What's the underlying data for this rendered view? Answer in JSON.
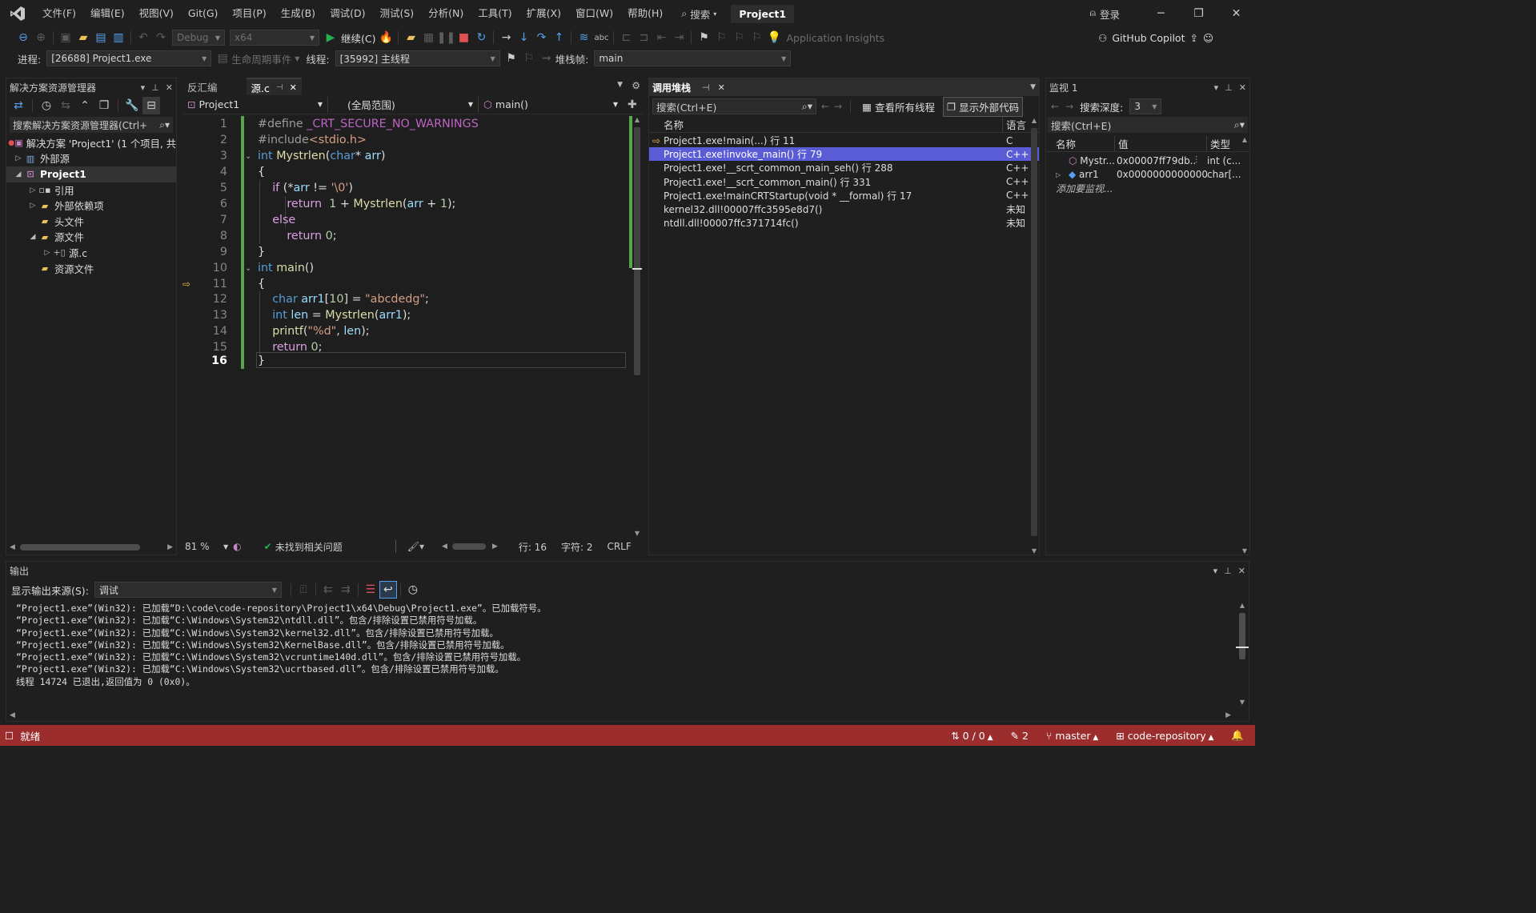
{
  "menu": {
    "items": [
      "文件(F)",
      "编辑(E)",
      "视图(V)",
      "Git(G)",
      "项目(P)",
      "生成(B)",
      "调试(D)",
      "测试(S)",
      "分析(N)",
      "工具(T)",
      "扩展(X)",
      "窗口(W)",
      "帮助(H)"
    ],
    "search_label": "搜索",
    "project_badge": "Project1",
    "login_label": "登录"
  },
  "toolbar": {
    "config": "Debug",
    "platform": "x64",
    "continue_label": "继续(C)",
    "app_insights": "Application Insights",
    "copilot": "GitHub Copilot"
  },
  "debugbar": {
    "process_label": "进程:",
    "process_value": "[26688] Project1.exe",
    "lifecycle_label": "生命周期事件",
    "thread_label": "线程:",
    "thread_value": "[35992] 主线程",
    "stackframe_label": "堆栈帧:",
    "stackframe_value": "main"
  },
  "solution_explorer": {
    "title": "解决方案资源管理器",
    "search_placeholder": "搜索解决方案资源管理器(Ctrl+",
    "items": [
      {
        "label": "解决方案 'Project1' (1 个项目, 共"
      },
      {
        "label": "外部源"
      },
      {
        "label": "Project1"
      },
      {
        "label": "引用"
      },
      {
        "label": "外部依赖项"
      },
      {
        "label": "头文件"
      },
      {
        "label": "源文件"
      },
      {
        "label": "源.c"
      },
      {
        "label": "资源文件"
      }
    ]
  },
  "editor": {
    "tabs": [
      {
        "label": "反汇编"
      },
      {
        "label": "源.c"
      }
    ],
    "nav_project": "Project1",
    "nav_scope": "(全局范围)",
    "nav_function": "main()",
    "zoom": "81 %",
    "issues": "未找到相关问题",
    "line_pos": "行: 16",
    "char_pos": "字符: 2",
    "eol": "CRLF",
    "line_numbers": [
      "1",
      "2",
      "3",
      "4",
      "5",
      "6",
      "7",
      "8",
      "9",
      "10",
      "11",
      "12",
      "13",
      "14",
      "15",
      "16"
    ]
  },
  "call_stack": {
    "title": "调用堆栈",
    "search_placeholder": "搜索(Ctrl+E)",
    "view_threads": "查看所有线程",
    "show_external": "显示外部代码",
    "col_name": "名称",
    "col_lang": "语言",
    "rows": [
      {
        "name": "Project1.exe!main(...) 行 11",
        "lang": "C"
      },
      {
        "name": "Project1.exe!invoke_main() 行 79",
        "lang": "C++"
      },
      {
        "name": "Project1.exe!__scrt_common_main_seh() 行 288",
        "lang": "C++"
      },
      {
        "name": "Project1.exe!__scrt_common_main() 行 331",
        "lang": "C++"
      },
      {
        "name": "Project1.exe!mainCRTStartup(void * __formal) 行 17",
        "lang": "C++"
      },
      {
        "name": "kernel32.dll!00007ffc3595e8d7()",
        "lang": "未知"
      },
      {
        "name": "ntdll.dll!00007ffc371714fc()",
        "lang": "未知"
      }
    ]
  },
  "watch": {
    "title": "监视 1",
    "depth_label": "搜索深度:",
    "depth_value": "3",
    "search_placeholder": "搜索(Ctrl+E)",
    "col_name": "名称",
    "col_value": "值",
    "col_type": "类型",
    "rows": [
      {
        "name": "Mystr...",
        "value": "0x00007ff79db...",
        "type": "int (c..."
      },
      {
        "name": "arr1",
        "value": "0x0000000000000...",
        "type": "char[..."
      }
    ],
    "add_item": "添加要监视..."
  },
  "output": {
    "title": "输出",
    "source_label": "显示输出来源(S):",
    "source_value": "调试",
    "lines": [
      "“Project1.exe”(Win32): 已加载“D:\\code\\code-repository\\Project1\\x64\\Debug\\Project1.exe”。已加载符号。",
      "“Project1.exe”(Win32): 已加载“C:\\Windows\\System32\\ntdll.dll”。包含/排除设置已禁用符号加载。",
      "“Project1.exe”(Win32): 已加载“C:\\Windows\\System32\\kernel32.dll”。包含/排除设置已禁用符号加载。",
      "“Project1.exe”(Win32): 已加载“C:\\Windows\\System32\\KernelBase.dll”。包含/排除设置已禁用符号加载。",
      "“Project1.exe”(Win32): 已加载“C:\\Windows\\System32\\vcruntime140d.dll”。包含/排除设置已禁用符号加载。",
      "“Project1.exe”(Win32): 已加载“C:\\Windows\\System32\\ucrtbased.dll”。包含/排除设置已禁用符号加载。",
      "线程 14724 已退出,返回值为 0 (0x0)。"
    ]
  },
  "statusbar": {
    "ready": "就绪",
    "sync": "0 / 0",
    "pending": "2",
    "branch": "master",
    "repo": "code-repository"
  },
  "colors": {
    "statusbar_bg": "#9b2d2d",
    "selection": "#5a5cd6",
    "keyword": "#569cd6",
    "string": "#d69d85"
  }
}
